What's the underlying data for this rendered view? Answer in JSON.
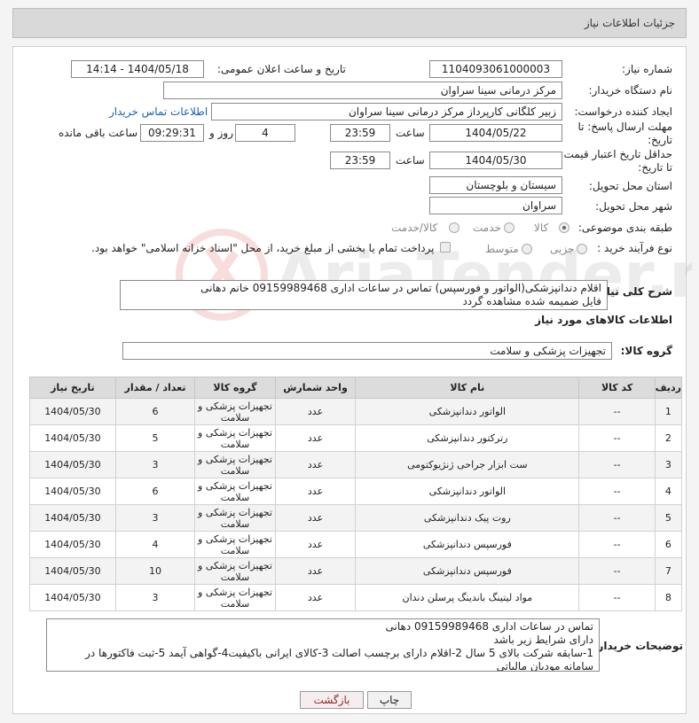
{
  "header": {
    "title": "جزئیات اطلاعات نیاز"
  },
  "fields": {
    "need_number_label": "شماره نیاز:",
    "need_number": "1104093061000003",
    "announce_label": "تاریخ و ساعت اعلان عمومی:",
    "announce_value": "1404/05/18 - 14:14",
    "buyer_label": "نام دستگاه خریدار:",
    "buyer_value": "مرکز درمانی سینا سراوان",
    "creator_label": "ایجاد کننده درخواست:",
    "creator_value": "زبیر کلگانی کارپرداز مرکز درمانی سینا سراوان",
    "contact_link": "اطلاعات تماس خریدار",
    "deadline_label": "مهلت ارسال پاسخ: تا تاریخ:",
    "deadline_date": "1404/05/22",
    "time_label": "ساعت",
    "deadline_time": "23:59",
    "days_value": "4",
    "days_label": "روز و",
    "remaining_time": "09:29:31",
    "remaining_label": "ساعت باقی مانده",
    "min_price_label": "حداقل تاریخ اعتبار قیمت: تا تاریخ:",
    "min_price_date": "1404/05/30",
    "min_price_time": "23:59",
    "province_label": "استان محل تحویل:",
    "province_value": "سیستان و بلوچستان",
    "city_label": "شهر محل تحویل:",
    "city_value": "سراوان",
    "category_label": "طبقه بندی موضوعی:",
    "category_options": [
      "کالا",
      "خدمت",
      "کالا/خدمت"
    ],
    "process_label": "نوع فرآیند خرید :",
    "process_options": [
      "جزیی",
      "متوسط"
    ],
    "payment_note": "پرداخت تمام یا بخشی از مبلغ خرید، از محل \"اسناد خزانه اسلامی\" خواهد بود.",
    "description_label": "شرح کلی نیاز:",
    "description_value": "اقلام دندانپزشکی(الواتور و فورسپس) تماس در ساعات اداری 09159989468 خانم دهانی\nفایل ضمیمه  شده مشاهده گردد",
    "goods_section": "اطلاعات کالاهای مورد نیاز",
    "goods_group_label": "گروه کالا:",
    "goods_group_value": "تجهیزات پزشکی و سلامت",
    "buyer_notes_label": "توضیحات خریدار:",
    "buyer_notes": "تماس در ساعات اداری 09159989468 دهانی\nدارای شرایط زیر باشد\n1-سابقه شرکت بالای 5 سال 2-اقلام دارای برچسب اصالت 3-کالای ایرانی باکیفیت4-گواهی آیمد 5-ثبت فاکتورها در سامانه مودیان مالیاتی"
  },
  "table": {
    "headers": [
      "ردیف",
      "کد کالا",
      "نام کالا",
      "واحد شمارش",
      "گروه کالا",
      "تعداد / مقدار",
      "تاریخ نیاز"
    ],
    "rows": [
      [
        "1",
        "--",
        "الواتور دندانپزشکی",
        "عدد",
        "تجهیزات پزشکی و سلامت",
        "6",
        "1404/05/30"
      ],
      [
        "2",
        "--",
        "رترکتور دندانپزشکی",
        "عدد",
        "تجهیزات پزشکی و سلامت",
        "5",
        "1404/05/30"
      ],
      [
        "3",
        "--",
        "ست ابزار جراحی ژنژیوکتومی",
        "عدد",
        "تجهیزات پزشکی و سلامت",
        "3",
        "1404/05/30"
      ],
      [
        "4",
        "--",
        "الواتور دندانپزشکی",
        "عدد",
        "تجهیزات پزشکی و سلامت",
        "6",
        "1404/05/30"
      ],
      [
        "5",
        "--",
        "روت پیک دندانپزشکی",
        "عدد",
        "تجهیزات پزشکی و سلامت",
        "3",
        "1404/05/30"
      ],
      [
        "6",
        "--",
        "فورسپس دندانپزشکی",
        "عدد",
        "تجهیزات پزشکی و سلامت",
        "4",
        "1404/05/30"
      ],
      [
        "7",
        "--",
        "فورسپس دندانپزشکی",
        "عدد",
        "تجهیزات پزشکی و سلامت",
        "10",
        "1404/05/30"
      ],
      [
        "8",
        "--",
        "مواد لیتینگ باندینگ پرسلن دندان",
        "عدد",
        "تجهیزات پزشکی و سلامت",
        "3",
        "1404/05/30"
      ]
    ]
  },
  "buttons": {
    "print": "چاپ",
    "back": "بازگشت"
  },
  "watermark": "AriaTender.neT"
}
